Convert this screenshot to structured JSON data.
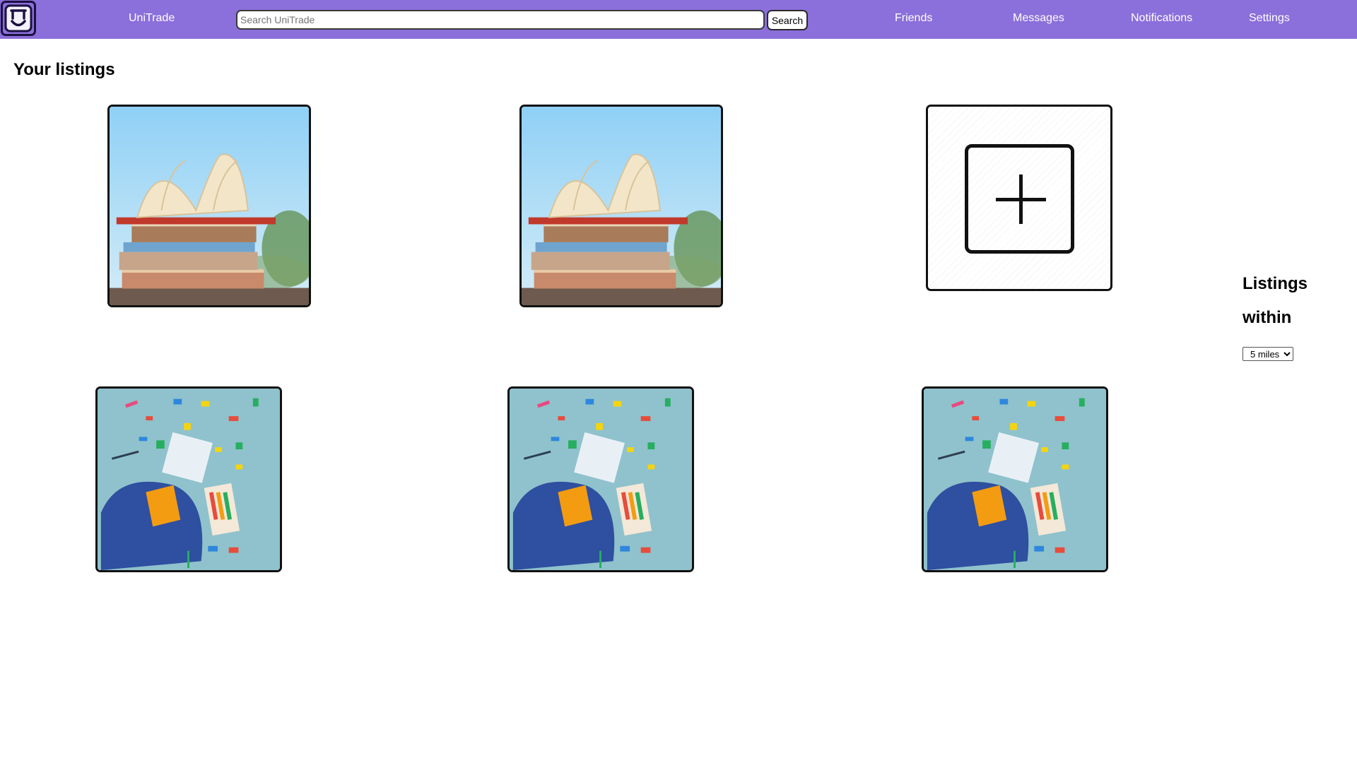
{
  "nav": {
    "brand": "UniTrade",
    "search_placeholder": "Search UniTrade",
    "search_value": "",
    "search_button": "Search",
    "links": {
      "friends": "Friends",
      "messages": "Messages",
      "notifications": "Notifications",
      "settings": "Settings"
    },
    "accent_color": "#8b6fdb"
  },
  "main": {
    "title": "Your listings",
    "listings": [
      {
        "image": "stack-of-books"
      },
      {
        "image": "stack-of-books"
      },
      {
        "image": "add-listing-icon"
      },
      {
        "image": "school-supplies-backpack"
      },
      {
        "image": "school-supplies-backpack"
      },
      {
        "image": "school-supplies-backpack"
      }
    ]
  },
  "filter": {
    "label_line1": "Listings",
    "label_line2": "within",
    "selected": "5 miles"
  }
}
